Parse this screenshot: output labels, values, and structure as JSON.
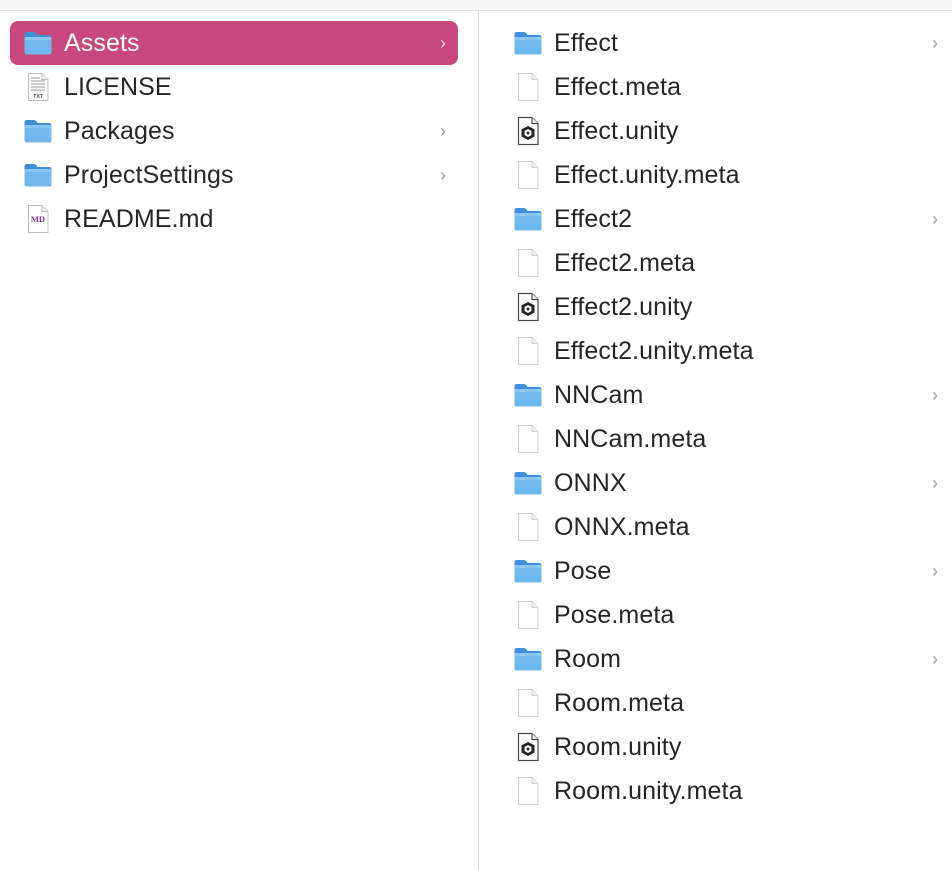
{
  "columns": [
    {
      "items": [
        {
          "name": "Assets",
          "type": "folder",
          "icon": "folder-icon",
          "has_children": true,
          "selected": true
        },
        {
          "name": "LICENSE",
          "type": "text",
          "icon": "text-file-icon",
          "badge": "TXT",
          "has_children": false,
          "selected": false
        },
        {
          "name": "Packages",
          "type": "folder",
          "icon": "folder-icon",
          "has_children": true,
          "selected": false
        },
        {
          "name": "ProjectSettings",
          "type": "folder",
          "icon": "folder-icon",
          "has_children": true,
          "selected": false
        },
        {
          "name": "README.md",
          "type": "markdown",
          "icon": "markdown-file-icon",
          "badge": "MD",
          "has_children": false,
          "selected": false
        }
      ]
    },
    {
      "items": [
        {
          "name": "Effect",
          "type": "folder",
          "icon": "folder-icon",
          "has_children": true
        },
        {
          "name": "Effect.meta",
          "type": "file",
          "icon": "file-icon",
          "has_children": false
        },
        {
          "name": "Effect.unity",
          "type": "unity",
          "icon": "unity-file-icon",
          "has_children": false
        },
        {
          "name": "Effect.unity.meta",
          "type": "file",
          "icon": "file-icon",
          "has_children": false
        },
        {
          "name": "Effect2",
          "type": "folder",
          "icon": "folder-icon",
          "has_children": true
        },
        {
          "name": "Effect2.meta",
          "type": "file",
          "icon": "file-icon",
          "has_children": false
        },
        {
          "name": "Effect2.unity",
          "type": "unity",
          "icon": "unity-file-icon",
          "has_children": false
        },
        {
          "name": "Effect2.unity.meta",
          "type": "file",
          "icon": "file-icon",
          "has_children": false
        },
        {
          "name": "NNCam",
          "type": "folder",
          "icon": "folder-icon",
          "has_children": true
        },
        {
          "name": "NNCam.meta",
          "type": "file",
          "icon": "file-icon",
          "has_children": false
        },
        {
          "name": "ONNX",
          "type": "folder",
          "icon": "folder-icon",
          "has_children": true
        },
        {
          "name": "ONNX.meta",
          "type": "file",
          "icon": "file-icon",
          "has_children": false
        },
        {
          "name": "Pose",
          "type": "folder",
          "icon": "folder-icon",
          "has_children": true
        },
        {
          "name": "Pose.meta",
          "type": "file",
          "icon": "file-icon",
          "has_children": false
        },
        {
          "name": "Room",
          "type": "folder",
          "icon": "folder-icon",
          "has_children": true
        },
        {
          "name": "Room.meta",
          "type": "file",
          "icon": "file-icon",
          "has_children": false
        },
        {
          "name": "Room.unity",
          "type": "unity",
          "icon": "unity-file-icon",
          "has_children": false
        },
        {
          "name": "Room.unity.meta",
          "type": "file",
          "icon": "file-icon",
          "has_children": false
        }
      ]
    }
  ],
  "chevron_glyph": "›",
  "colors": {
    "selection": "#c8477d",
    "folder": "#5aa9e6",
    "text": "#262626",
    "markdown_badge": "#8b2f9a"
  }
}
